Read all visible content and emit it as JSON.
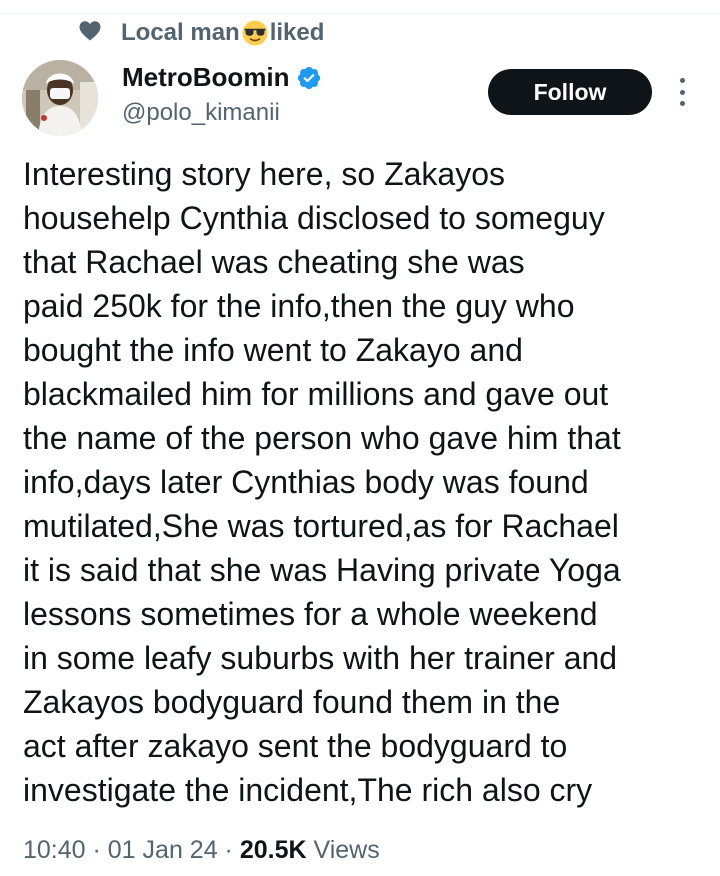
{
  "social_context": {
    "text_before": "Local man",
    "emoji": "sunglasses-emoji",
    "text_after": " liked",
    "icon": "heart-icon"
  },
  "author": {
    "display_name": "MetroBoomin",
    "handle": "@polo_kimanii",
    "verified": true,
    "verified_color": "#1d9bf0"
  },
  "follow_button": {
    "label": "Follow"
  },
  "tweet": {
    "lines": [
      "Interesting story here, so Zakayos",
      "househelp Cynthia disclosed to someguy",
      "that Rachael was cheating she was",
      "paid 250k for the info,then the guy who",
      "bought the info went to Zakayo and",
      "blackmailed him for millions and gave out",
      "the name of the person who gave him that",
      "info,days later Cynthias body was found",
      "mutilated,She was tortured,as for Rachael",
      "it is said that she was Having private Yoga",
      "lessons sometimes for a whole weekend",
      "in some leafy suburbs with her trainer and",
      "Zakayos bodyguard found them in the",
      "act after zakayo sent the bodyguard to",
      "investigate the incident,The rich also cry"
    ]
  },
  "meta": {
    "time": "10:40",
    "sep1": " · ",
    "date": "01 Jan 24",
    "sep2": " · ",
    "views_count": "20.5K",
    "views_label": " Views"
  },
  "colors": {
    "text_primary": "#0f1419",
    "text_secondary": "#536471",
    "button_bg": "#0f1419",
    "verified": "#1d9bf0"
  }
}
